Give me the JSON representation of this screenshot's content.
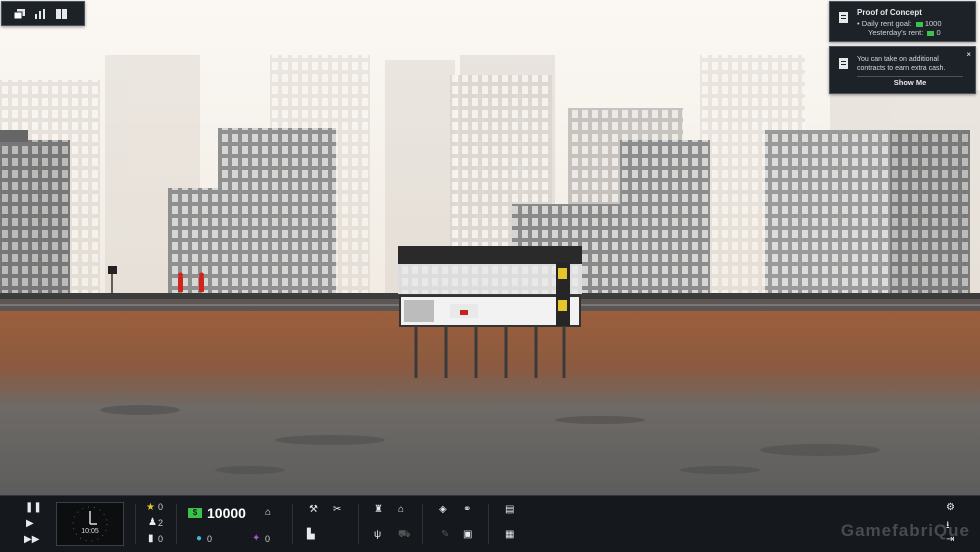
{
  "goal": {
    "title": "Proof of Concept",
    "rent_goal_label": "Daily rent goal:",
    "rent_goal_value": "1000",
    "yesterday_label": "Yesterday's rent:",
    "yesterday_value": "0"
  },
  "notice": {
    "message": "You can take on additional contracts to earn extra cash.",
    "button": "Show Me",
    "close": "×"
  },
  "hud": {
    "clock_time": "10:05",
    "stars": "0",
    "workers": "2",
    "tenants": "0",
    "money": "10000",
    "cash_symbol": "$",
    "eco": "0",
    "influence": "0"
  },
  "watermark": "GamefabriQue",
  "colors": {
    "panel_bg": "#1d2228",
    "hud_bg": "#15191d",
    "cash_green": "#3cc24a",
    "ground_top": "#8e5a3d",
    "ground_bottom": "#6b6b6b",
    "worker_red": "#d0241d"
  }
}
